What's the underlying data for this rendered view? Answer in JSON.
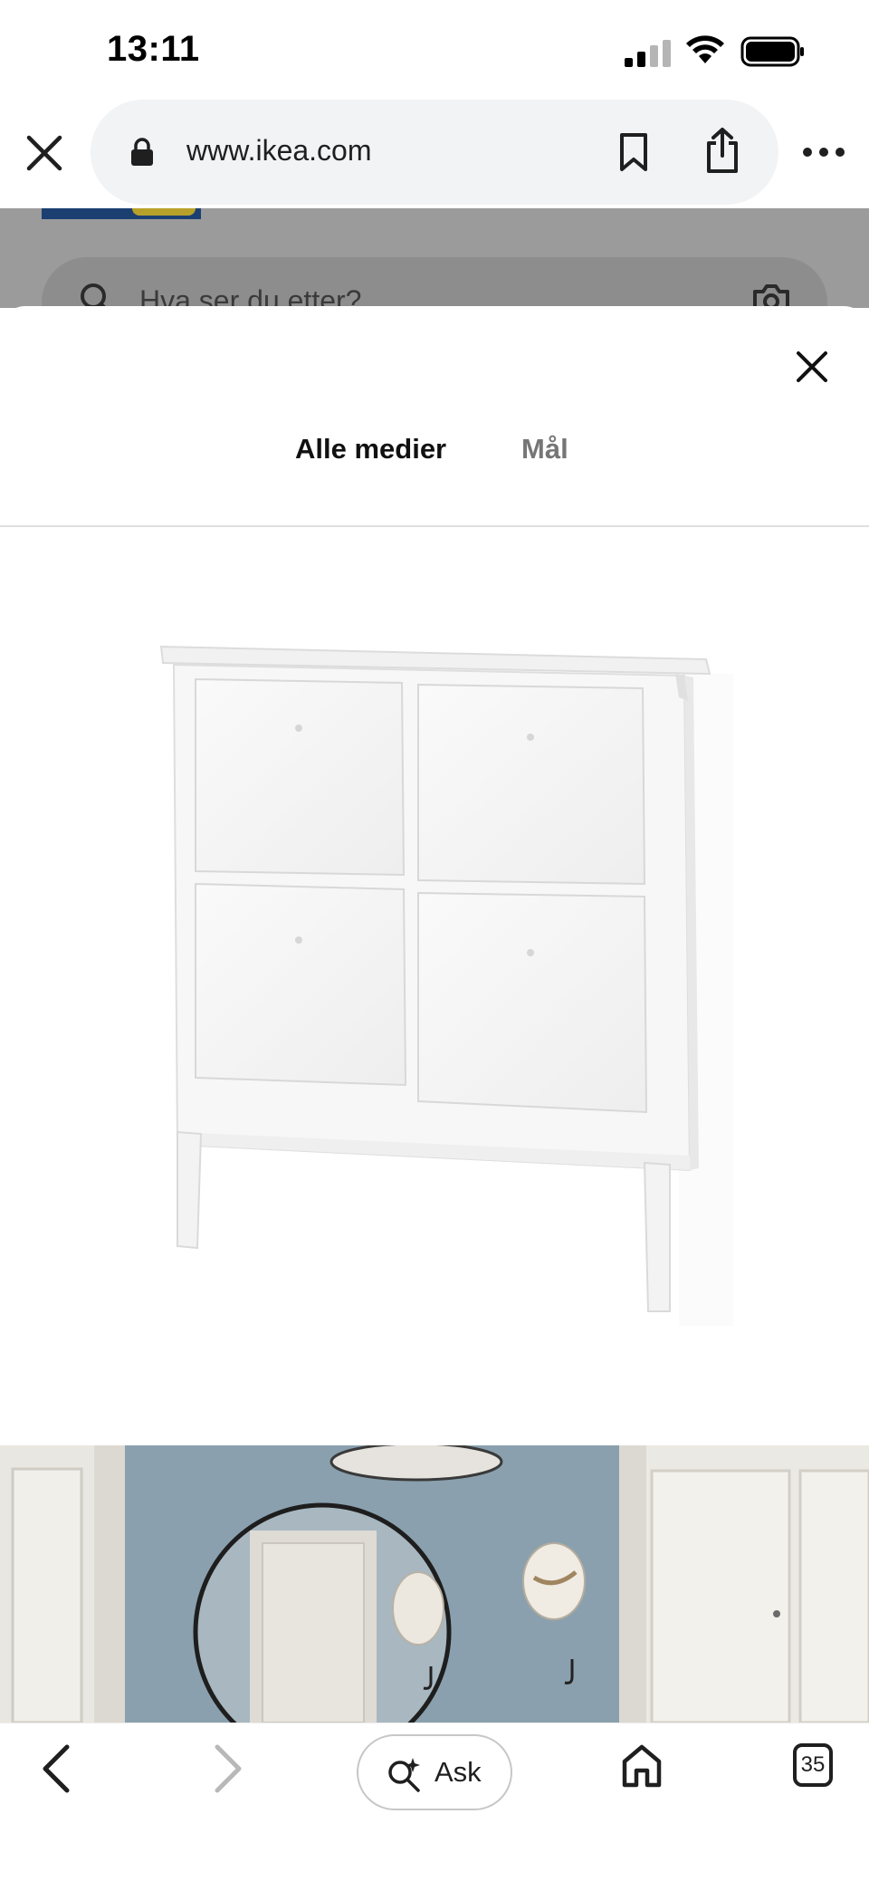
{
  "status_bar": {
    "time": "13:11"
  },
  "browser": {
    "url": "www.ikea.com",
    "icons": [
      "close-icon",
      "lock-icon",
      "bookmark-icon",
      "share-icon",
      "more-icon"
    ]
  },
  "background_page": {
    "search_placeholder": "Hva ser du etter?"
  },
  "modal": {
    "tabs": [
      {
        "label": "Alle medier",
        "active": true
      },
      {
        "label": "Mål",
        "active": false
      }
    ],
    "accent_color": "#0058a3"
  },
  "bottom_bar": {
    "ask_label": "Ask",
    "tab_count": "35"
  }
}
